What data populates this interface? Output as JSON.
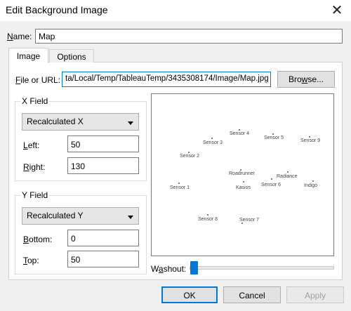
{
  "window": {
    "title": "Edit Background Image",
    "close_glyph": "✕"
  },
  "name_field": {
    "label_key": "N",
    "label_rest": "ame:",
    "value": "Map"
  },
  "tabs": [
    {
      "label": "Image",
      "active": true
    },
    {
      "label": "Options",
      "active": false
    }
  ],
  "file": {
    "label_key": "F",
    "label_rest": "ile or URL:",
    "value": "ta/Local/Temp/TableauTemp/3435308174/Image/Map.jpg",
    "browse_pre": "Bro",
    "browse_key": "w",
    "browse_post": "se..."
  },
  "x_field": {
    "group_title": "X Field",
    "selected": "Recalculated X",
    "left_key": "L",
    "left_rest": "eft:",
    "left_value": "50",
    "right_key": "R",
    "right_rest": "ight:",
    "right_value": "130"
  },
  "y_field": {
    "group_title": "Y Field",
    "selected": "Recalculated Y",
    "bottom_key": "B",
    "bottom_rest": "ottom:",
    "bottom_value": "0",
    "top_key": "T",
    "top_rest": "op:",
    "top_value": "50"
  },
  "preview": {
    "sensors": [
      {
        "label": "Sensor 4"
      },
      {
        "label": "Sensor 3"
      },
      {
        "label": "Sensor 5"
      },
      {
        "label": "Sensor 9"
      },
      {
        "label": "Sensor 2"
      },
      {
        "label": "Roadrunner"
      },
      {
        "label": "Radiance"
      },
      {
        "label": "Sensor 1"
      },
      {
        "label": "Kasios"
      },
      {
        "label": "Sensor 6"
      },
      {
        "label": "Indigo"
      },
      {
        "label": "Sensor 8"
      },
      {
        "label": "Sensor 7"
      }
    ]
  },
  "washout": {
    "label_pre": "W",
    "label_key": "a",
    "label_post": "shout:",
    "level_percent": 0
  },
  "buttons": {
    "ok": "OK",
    "cancel": "Cancel",
    "apply": "Apply"
  },
  "colors": {
    "accent": "#0078d7"
  }
}
